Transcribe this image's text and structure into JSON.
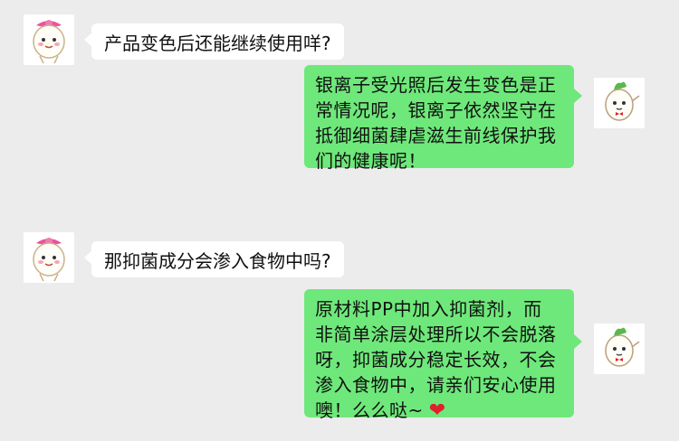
{
  "colors": {
    "background": "#ececec",
    "bubble_incoming": "#ffffff",
    "bubble_outgoing": "#6ee87a",
    "heart": "#e0202a"
  },
  "messages": [
    {
      "side": "left",
      "avatar_icon": "radish-girl-avatar-icon",
      "lines": [
        "产品变色后还能继续使用咩?"
      ]
    },
    {
      "side": "right",
      "avatar_icon": "radish-boy-avatar-icon",
      "lines": [
        "银离子受光照后发生变色是正",
        "常情况呢，银离子依然坚守在",
        "抵御细菌肆虐滋生前线保护我",
        "们的健康呢！"
      ]
    },
    {
      "side": "left",
      "avatar_icon": "radish-girl-avatar-icon",
      "lines": [
        "那抑菌成分会渗入食物中吗?"
      ]
    },
    {
      "side": "right",
      "avatar_icon": "radish-boy-avatar-icon",
      "lines": [
        "原材料PP中加入抑菌剂，而",
        "非简单涂层处理所以不会脱落",
        "呀，抑菌成分稳定长效，不会",
        "渗入食物中，请亲们安心使用",
        "噢！么么哒~"
      ],
      "trailing_icon": "heart-icon"
    }
  ]
}
